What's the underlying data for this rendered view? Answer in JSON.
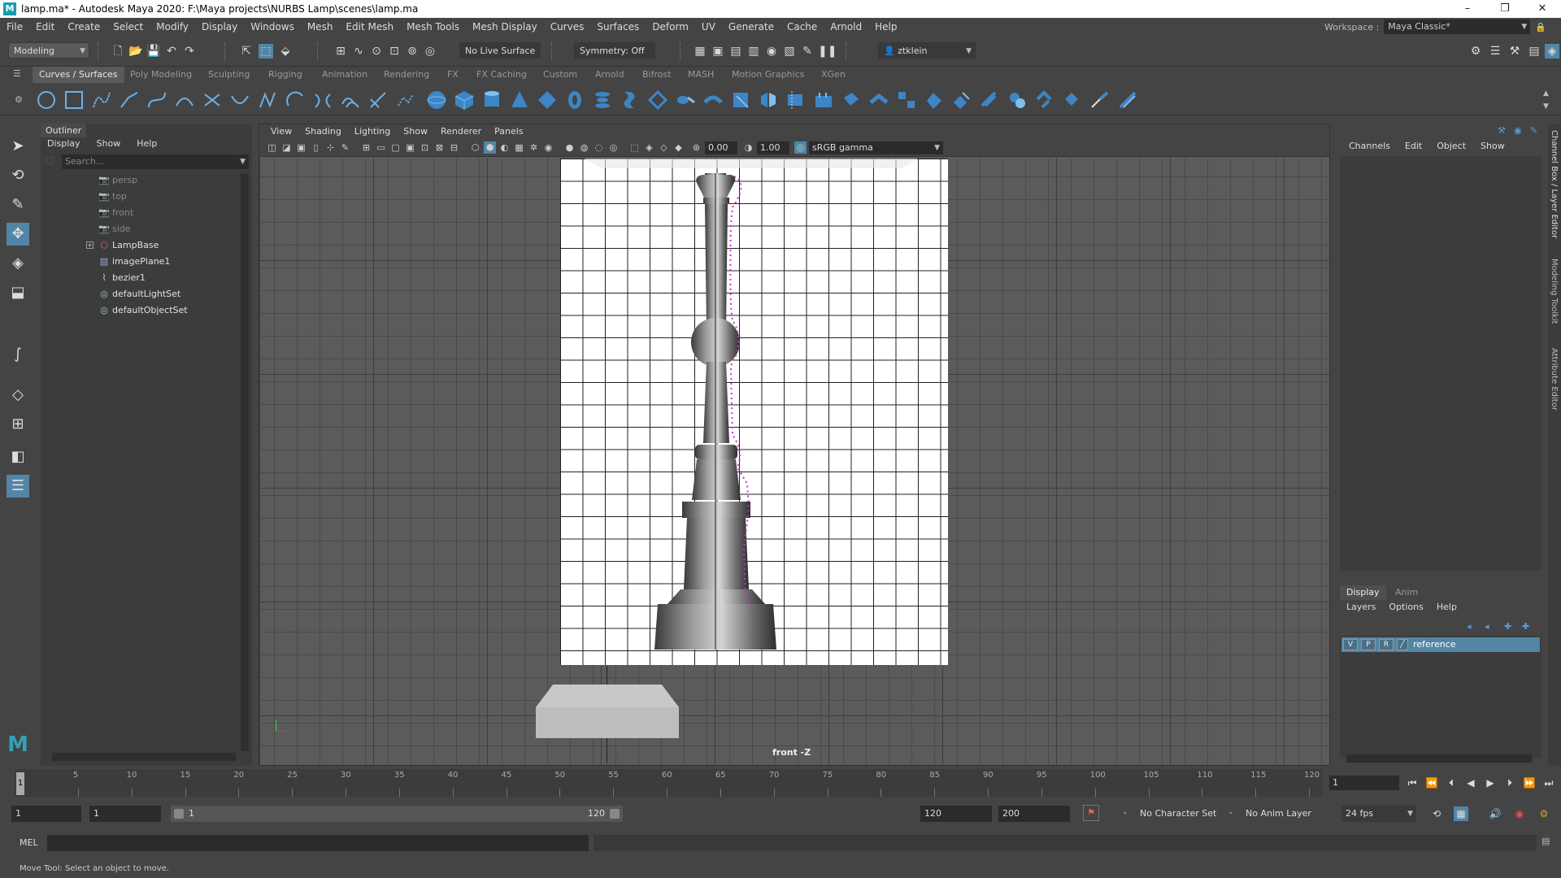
{
  "window": {
    "title": "lamp.ma* - Autodesk Maya 2020: F:\\Maya projects\\NURBS Lamp\\scenes\\lamp.ma",
    "app_icon": "M",
    "buttons": [
      "–",
      "❒",
      "✕"
    ]
  },
  "menubar": {
    "items": [
      "File",
      "Edit",
      "Create",
      "Select",
      "Modify",
      "Display",
      "Windows",
      "Mesh",
      "Edit Mesh",
      "Mesh Tools",
      "Mesh Display",
      "Curves",
      "Surfaces",
      "Deform",
      "UV",
      "Generate",
      "Cache",
      "Arnold",
      "Help"
    ],
    "workspace_label": "Workspace :",
    "workspace_value": "Maya Classic*"
  },
  "statusline": {
    "menuset": "Modeling",
    "live_surface": "No Live Surface",
    "symmetry": "Symmetry: Off",
    "user": "ztklein"
  },
  "shelf": {
    "tabs": [
      "Curves / Surfaces",
      "Poly Modeling",
      "Sculpting",
      "Rigging",
      "Animation",
      "Rendering",
      "FX",
      "FX Caching",
      "Custom",
      "Arnold",
      "Bifrost",
      "MASH",
      "Motion Graphics",
      "XGen"
    ],
    "active_tab": 0
  },
  "outliner": {
    "title": "Outliner",
    "menu": [
      "Display",
      "Show",
      "Help"
    ],
    "search_placeholder": "Search...",
    "items": [
      {
        "label": "persp",
        "icon": "camera-icon",
        "dim": true
      },
      {
        "label": "top",
        "icon": "camera-icon",
        "dim": true
      },
      {
        "label": "front",
        "icon": "camera-icon",
        "dim": true
      },
      {
        "label": "side",
        "icon": "camera-icon",
        "dim": true
      },
      {
        "label": "LampBase",
        "icon": "transform-icon",
        "dim": false,
        "expandable": true
      },
      {
        "label": "imagePlane1",
        "icon": "image-plane-icon",
        "dim": false
      },
      {
        "label": "bezier1",
        "icon": "curve-icon",
        "dim": false
      },
      {
        "label": "defaultLightSet",
        "icon": "set-icon",
        "dim": false
      },
      {
        "label": "defaultObjectSet",
        "icon": "set-icon",
        "dim": false
      }
    ]
  },
  "viewport": {
    "menu": [
      "View",
      "Shading",
      "Lighting",
      "Show",
      "Renderer",
      "Panels"
    ],
    "near_value": "0.00",
    "far_value": "1.00",
    "color_space": "sRGB gamma",
    "camera_label": "front -Z"
  },
  "channelbox": {
    "menu": [
      "Channels",
      "Edit",
      "Object",
      "Show"
    ],
    "layer_tabs": [
      "Display",
      "Anim"
    ],
    "layer_menu": [
      "Layers",
      "Options",
      "Help"
    ],
    "layer": {
      "v": "V",
      "p": "P",
      "r": "R",
      "name": "reference"
    },
    "side_tabs": [
      "Channel Box / Layer Editor",
      "Modeling Toolkit",
      "Attribute Editor"
    ]
  },
  "timeline": {
    "ticks": [
      "5",
      "10",
      "15",
      "20",
      "25",
      "30",
      "35",
      "40",
      "45",
      "50",
      "55",
      "60",
      "65",
      "70",
      "75",
      "80",
      "85",
      "90",
      "95",
      "100",
      "105",
      "110",
      "115",
      "120"
    ],
    "current_frame_marker": "1",
    "current_frame": "1"
  },
  "range": {
    "start": "1",
    "playback_start": "1",
    "slider_start": "1",
    "slider_end": "120",
    "playback_end": "120",
    "end": "200",
    "character_set": "No Character Set",
    "anim_layer": "No Anim Layer",
    "fps": "24 fps"
  },
  "cmdline": {
    "mode": "MEL"
  },
  "helpline": {
    "text": "Move Tool: Select an object to move."
  }
}
